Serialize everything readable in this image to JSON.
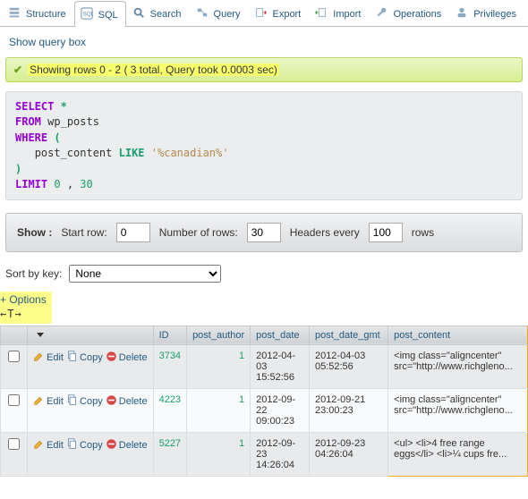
{
  "tabs": {
    "structure": "Structure",
    "sql": "SQL",
    "search": "Search",
    "query": "Query",
    "export": "Export",
    "import": "Import",
    "operations": "Operations",
    "privileges": "Privileges"
  },
  "links": {
    "show_query_box": "Show query box",
    "options": "+ Options"
  },
  "notice": {
    "text": "Showing rows 0 - 2 ( 3 total, Query took 0.0003 sec)"
  },
  "sql": {
    "select": "SELECT",
    "star": "*",
    "from": "FROM",
    "table": "wp_posts",
    "where": "WHERE",
    "col": "post_content",
    "like": "LIKE",
    "pattern": "'%canadian%'",
    "limit": "LIMIT",
    "lim_a": "0",
    "lim_b": "30"
  },
  "show": {
    "label": "Show :",
    "start_label": "Start row:",
    "start_value": "0",
    "num_label": "Number of rows:",
    "num_value": "30",
    "headers_label": "Headers every",
    "headers_value": "100",
    "rows_label": "rows"
  },
  "sort": {
    "label": "Sort by key:",
    "value": "None"
  },
  "arrows": "←T→",
  "table": {
    "headers": {
      "id": "ID",
      "author": "post_author",
      "date": "post_date",
      "gmt": "post_date_gmt",
      "content": "post_content"
    },
    "actions": {
      "edit": "Edit",
      "copy": "Copy",
      "delete": "Delete"
    },
    "rows": [
      {
        "id": "3734",
        "author": "1",
        "date": "2012-04-03 15:52:56",
        "gmt": "2012-04-03 05:52:56",
        "content": "<img class=\"aligncenter\" src=\"http://www.richgleno..."
      },
      {
        "id": "4223",
        "author": "1",
        "date": "2012-09-22 09:00:23",
        "gmt": "2012-09-21 23:00:23",
        "content": "<img class=\"aligncenter\" src=\"http://www.richgleno..."
      },
      {
        "id": "5227",
        "author": "1",
        "date": "2012-09-23 14:26:04",
        "gmt": "2012-09-23 04:26:04",
        "content": "<ul>\n<li>4 free range eggs</li>\n<li>¼ cups fre..."
      }
    ]
  }
}
